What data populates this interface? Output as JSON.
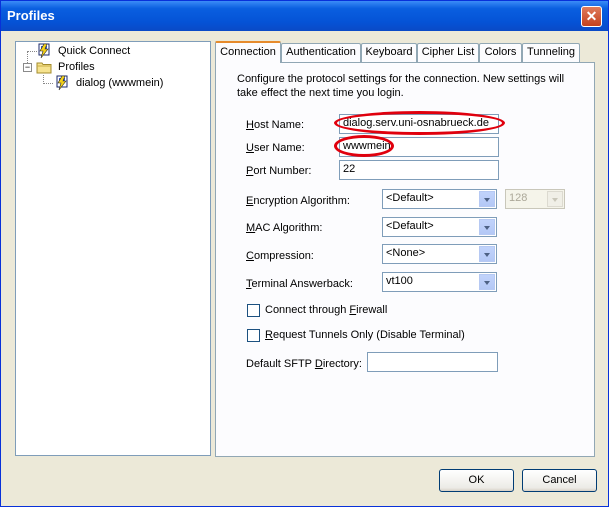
{
  "window": {
    "title": "Profiles",
    "close_glyph": "✕"
  },
  "tree": {
    "items": [
      {
        "label": "Quick Connect",
        "icon": "computer-lightning-icon"
      },
      {
        "label": "Profiles",
        "icon": "folder-icon",
        "expander": "−"
      },
      {
        "label": "dialog (wwwmein)",
        "icon": "computer-lightning-icon"
      }
    ]
  },
  "tabs": [
    "Connection",
    "Authentication",
    "Keyboard",
    "Cipher List",
    "Colors",
    "Tunneling"
  ],
  "connection": {
    "description": "Configure the protocol settings for the connection. New settings will take effect the next time you login.",
    "host_name_label": "Host Name:",
    "host_name_value": "dialog.serv.uni-osnabrueck.de",
    "user_name_label": "User Name:",
    "user_name_value": "wwwmein",
    "port_label": "Port Number:",
    "port_value": "22",
    "encryption_label": "Encryption Algorithm:",
    "encryption_value": "<Default>",
    "key_size_value": "128",
    "mac_label": "MAC Algorithm:",
    "mac_value": "<Default>",
    "compression_label": "Compression:",
    "compression_value": "<None>",
    "answerback_label": "Terminal Answerback:",
    "answerback_value": "vt100",
    "firewall_label": "Connect through Firewall",
    "firewall_checked": false,
    "tunnels_label": "Request Tunnels Only (Disable Terminal)",
    "tunnels_checked": false,
    "sftp_label": "Default SFTP Directory:",
    "sftp_value": ""
  },
  "buttons": {
    "ok": "OK",
    "cancel": "Cancel"
  },
  "colors": {
    "titlebar": "#0553d6",
    "active_tab_accent": "#e68b2c",
    "highlight_oval": "#e0000d"
  }
}
